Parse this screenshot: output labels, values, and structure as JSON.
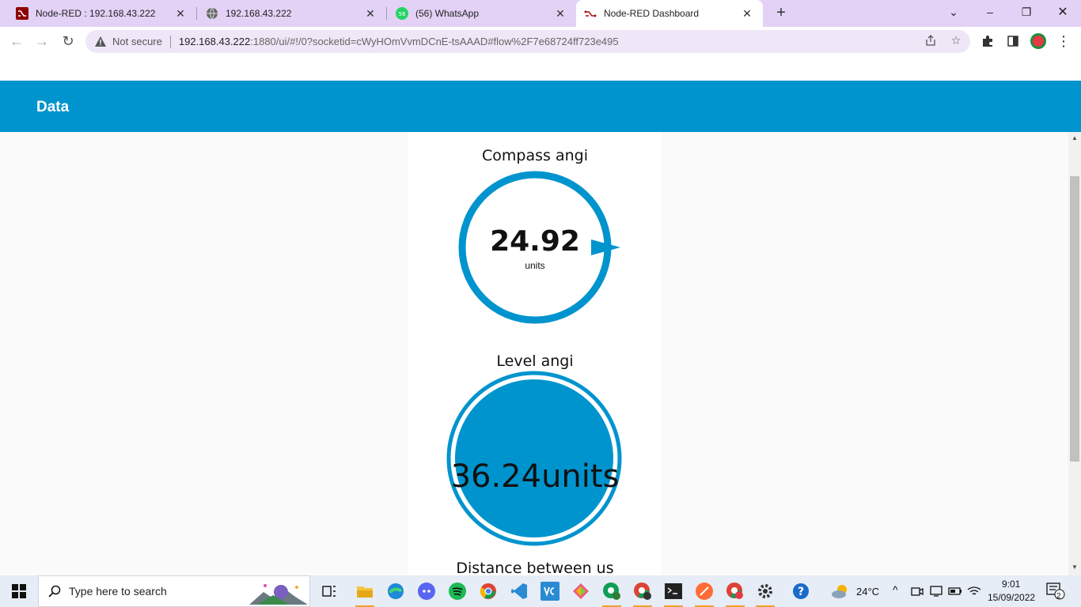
{
  "browser": {
    "tabs": [
      {
        "title": "Node-RED : 192.168.43.222",
        "active": false
      },
      {
        "title": "192.168.43.222",
        "active": false
      },
      {
        "title": "(56) WhatsApp",
        "active": false,
        "badge": "56"
      },
      {
        "title": "Node-RED Dashboard",
        "active": true
      }
    ],
    "security_label": "Not secure",
    "url_host": "192.168.43.222",
    "url_rest": ":1880/ui/#!/0?socketid=cWyHOmVvmDCnE-tsAAAD#flow%2F7e68724ff723e495"
  },
  "dashboard": {
    "title": "Data",
    "header_color": "#0094ce",
    "widgets": [
      {
        "title": "Compass angi",
        "value": "24.92",
        "units": "units"
      },
      {
        "title": "Level angi",
        "value": "36.24units"
      },
      {
        "title": "Distance between us"
      }
    ]
  },
  "taskbar": {
    "search_placeholder": "Type here to search",
    "weather_temp": "24°C",
    "time": "9:01",
    "date": "15/09/2022",
    "notification_count": "2"
  }
}
